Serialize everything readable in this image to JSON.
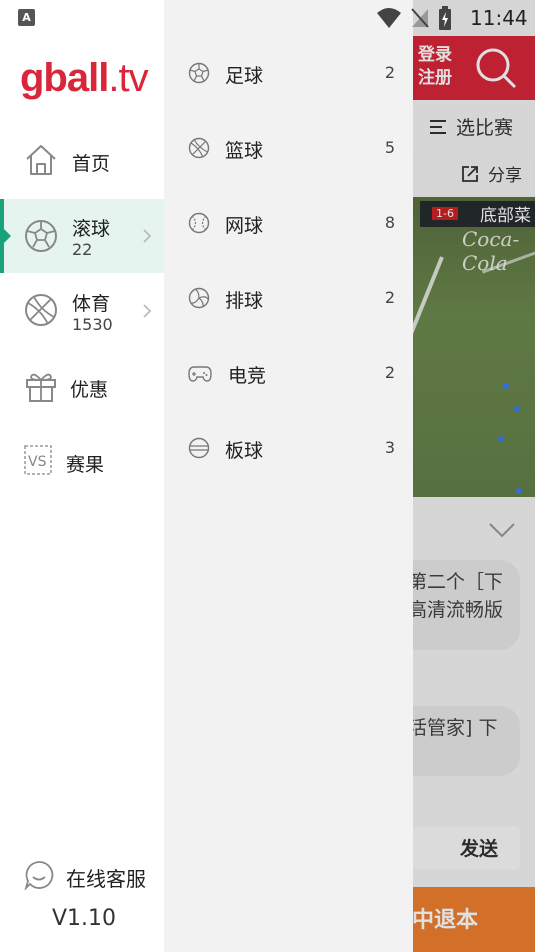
{
  "status_bar": {
    "indicator": "A",
    "time": "11:44"
  },
  "background": {
    "login": "登录",
    "register": "注册",
    "filter": "选比赛",
    "share": "分享",
    "video_score": "1-6",
    "video_team": "底部菜",
    "video_sponsor": "Coca-Cola",
    "message1": "第二个［下高清流畅版",
    "message2": "活管家] 下",
    "send": "发送",
    "footer_banner": "中退本"
  },
  "logo": {
    "text_main": "gball",
    "text_dot": ".tv",
    "color": "#d9263a"
  },
  "nav": {
    "items": [
      {
        "label": "首页",
        "icon": "home-icon"
      },
      {
        "label": "滚球",
        "count": "22",
        "icon": "soccer-ball-icon",
        "active": true
      },
      {
        "label": "体育",
        "count": "1530",
        "icon": "basketball-icon"
      },
      {
        "label": "优惠",
        "icon": "gift-icon"
      },
      {
        "label": "赛果",
        "icon": "vs-icon"
      }
    ],
    "active_color": "#1aa37a"
  },
  "support": {
    "label": "在线客服",
    "icon": "chat-bubble-icon"
  },
  "version": "V1.10",
  "submenu": {
    "items": [
      {
        "label": "足球",
        "count": "2",
        "icon": "soccer-ball-icon"
      },
      {
        "label": "篮球",
        "count": "5",
        "icon": "basketball-icon"
      },
      {
        "label": "网球",
        "count": "8",
        "icon": "tennis-ball-icon"
      },
      {
        "label": "排球",
        "count": "2",
        "icon": "volleyball-icon"
      },
      {
        "label": "电竞",
        "count": "2",
        "icon": "gamepad-icon"
      },
      {
        "label": "板球",
        "count": "3",
        "icon": "cricket-ball-icon"
      }
    ]
  }
}
